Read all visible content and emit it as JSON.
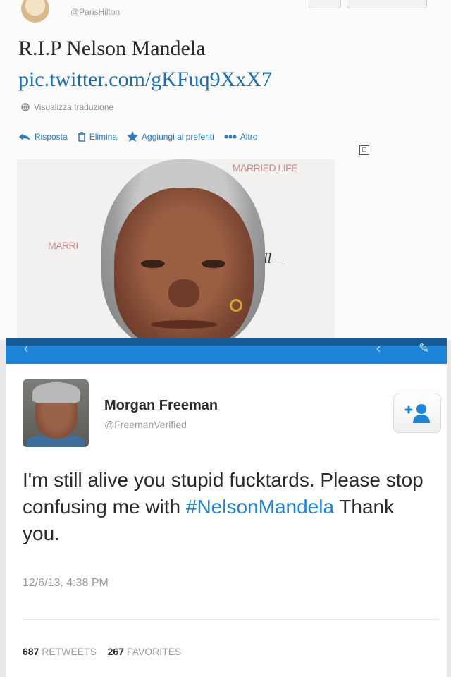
{
  "top_tweet": {
    "handle": "@ParisHilton",
    "text": "R.I.P Nelson Mandela",
    "link": "pic.twitter.com/gKFuq9XxX7",
    "translate_label": "Visualizza traduzione",
    "actions": [
      {
        "label": "Risposta",
        "icon": "reply-icon"
      },
      {
        "label": "Elimina",
        "icon": "trash-icon"
      },
      {
        "label": "Aggiungi ai preferiti",
        "icon": "star-icon"
      },
      {
        "label": "Altro",
        "icon": "more-icon"
      }
    ],
    "photo_text": {
      "married_life": "MARRIED LIFE",
      "marr": "MARRI"
    }
  },
  "bottom_tweet": {
    "name": "Morgan Freeman",
    "handle": "@FreemanVerified",
    "text_before": "I'm still alive you stupid fucktards. Please stop confusing me with ",
    "hashtag": "#NelsonMandela",
    "text_after": " Thank you.",
    "timestamp": "12/6/13, 4:38 PM",
    "retweets_count": "687",
    "retweets_label": "RETWEETS",
    "favorites_count": "267",
    "favorites_label": "FAVORITES"
  },
  "colors": {
    "link_blue": "#1d6fae",
    "bar_blue": "#1c83d6"
  }
}
